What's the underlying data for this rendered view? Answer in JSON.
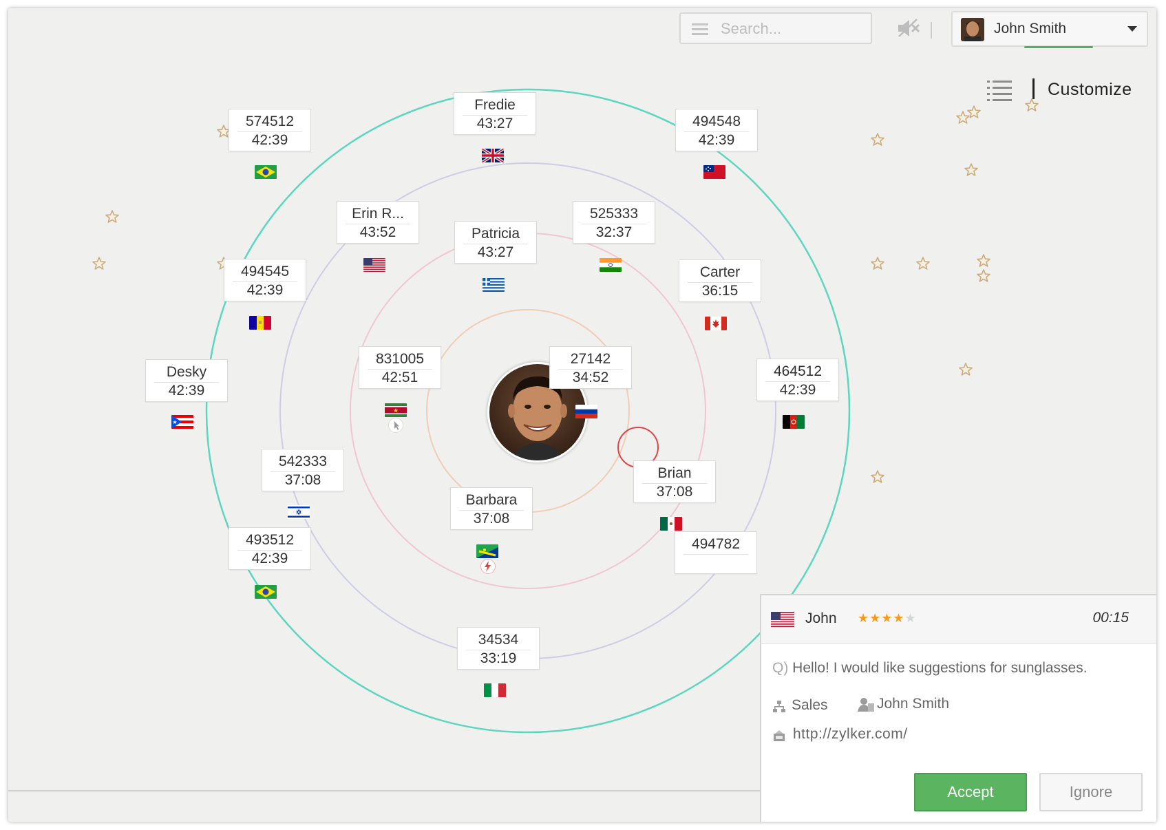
{
  "search": {
    "placeholder": "Search..."
  },
  "user": {
    "name": "John Smith"
  },
  "toolbar": {
    "customize_label": "Customize"
  },
  "visitors": [
    {
      "line1": "574512",
      "line2": "42:39",
      "flag": "brazil"
    },
    {
      "line1": "Fredie",
      "line2": "43:27",
      "flag": "uk"
    },
    {
      "line1": "494548",
      "line2": "42:39",
      "flag": "samoa"
    },
    {
      "line1": "Erin R...",
      "line2": "43:52",
      "flag": "usa"
    },
    {
      "line1": "Patricia",
      "line2": "43:27",
      "flag": "greece"
    },
    {
      "line1": "525333",
      "line2": "32:37",
      "flag": "india"
    },
    {
      "line1": "494545",
      "line2": "42:39",
      "flag": "andorra"
    },
    {
      "line1": "Carter",
      "line2": "36:15",
      "flag": "canada"
    },
    {
      "line1": "831005",
      "line2": "42:51",
      "flag": "suriname"
    },
    {
      "line1": "27142",
      "line2": "34:52",
      "flag": "russia"
    },
    {
      "line1": "Desky",
      "line2": "42:39",
      "flag": "puerto-rico"
    },
    {
      "line1": "464512",
      "line2": "42:39",
      "flag": "afghanistan"
    },
    {
      "line1": "542333",
      "line2": "37:08",
      "flag": "israel"
    },
    {
      "line1": "Brian",
      "line2": "37:08",
      "flag": "mexico"
    },
    {
      "line1": "Barbara",
      "line2": "37:08",
      "flag": "cape-verde"
    },
    {
      "line1": "493512",
      "line2": "42:39",
      "flag": "brazil"
    },
    {
      "line1": "494782",
      "line2": "",
      "flag": ""
    },
    {
      "line1": "34534",
      "line2": "33:19",
      "flag": "italy"
    }
  ],
  "chat": {
    "visitor_name": "John",
    "rating_stars": "★★★★",
    "rating_empty": "★",
    "rating": 4,
    "timer": "00:15",
    "q_prefix": "Q)",
    "question": "Hello! I would like suggestions for sunglasses.",
    "department": "Sales",
    "agent": "John Smith",
    "url": "http://zylker.com/",
    "accept_label": "Accept",
    "ignore_label": "Ignore"
  },
  "colors": {
    "accent_green": "#5bb560",
    "ring_outer": "#5dd6c0",
    "ring_middle": "#c9c9e6",
    "ring_inner": "#f0c5cc",
    "ring_core": "#f3cbb3",
    "star_rating": "#f39c23"
  }
}
